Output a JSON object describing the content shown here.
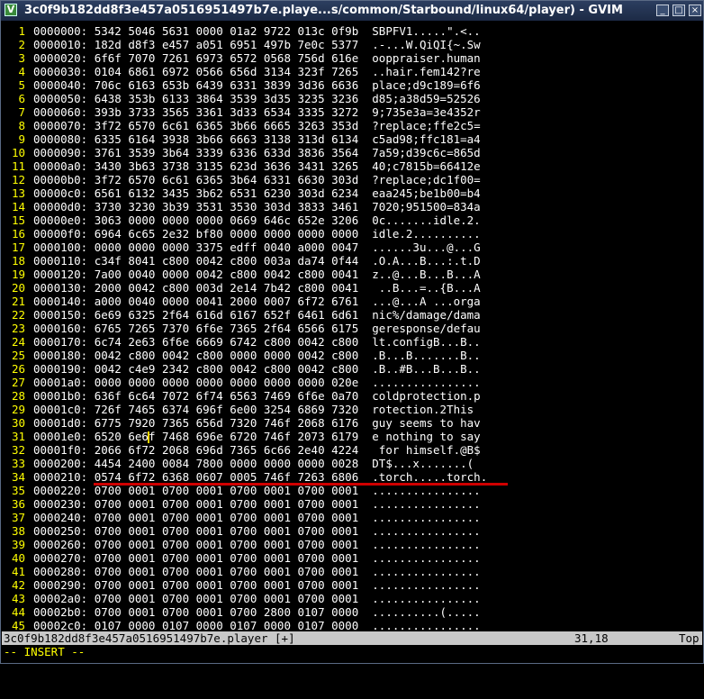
{
  "window": {
    "title": "3c0f9b182dd8f3e457a0516951497b7e.playe...s/common/Starbound/linux64/player) - GVIM",
    "buttons": {
      "minimize": "_",
      "maximize": "□",
      "close": "×"
    }
  },
  "buffer": {
    "lines": [
      {
        "n": "1",
        "text": "0000000: 5342 5046 5631 0000 01a2 9722 013c 0f9b  SBPFV1.....\".<.."
      },
      {
        "n": "2",
        "text": "0000010: 182d d8f3 e457 a051 6951 497b 7e0c 5377  .-...W.QiQI{~.Sw"
      },
      {
        "n": "3",
        "text": "0000020: 6f6f 7070 7261 6973 6572 0568 756d 616e  ooppraiser.human"
      },
      {
        "n": "4",
        "text": "0000030: 0104 6861 6972 0566 656d 3134 323f 7265  ..hair.fem142?re"
      },
      {
        "n": "5",
        "text": "0000040: 706c 6163 653b 6439 6331 3839 3d36 6636  place;d9c189=6f6"
      },
      {
        "n": "6",
        "text": "0000050: 6438 353b 6133 3864 3539 3d35 3235 3236  d85;a38d59=52526"
      },
      {
        "n": "7",
        "text": "0000060: 393b 3733 3565 3361 3d33 6534 3335 3272  9;735e3a=3e4352r"
      },
      {
        "n": "8",
        "text": "0000070: 3f72 6570 6c61 6365 3b66 6665 3263 353d  ?replace;ffe2c5="
      },
      {
        "n": "9",
        "text": "0000080: 6335 6164 3938 3b66 6663 3138 313d 6134  c5ad98;ffc181=a4"
      },
      {
        "n": "10",
        "text": "0000090: 3761 3539 3b64 3339 6336 633d 3836 3564  7a59;d39c6c=865d"
      },
      {
        "n": "11",
        "text": "00000a0: 3430 3b63 3738 3135 623d 3636 3431 3265  40;c7815b=66412e"
      },
      {
        "n": "12",
        "text": "00000b0: 3f72 6570 6c61 6365 3b64 6331 6630 303d  ?replace;dc1f00="
      },
      {
        "n": "13",
        "text": "00000c0: 6561 6132 3435 3b62 6531 6230 303d 6234  eaa245;be1b00=b4"
      },
      {
        "n": "14",
        "text": "00000d0: 3730 3230 3b39 3531 3530 303d 3833 3461  7020;951500=834a"
      },
      {
        "n": "15",
        "text": "00000e0: 3063 0000 0000 0000 0669 646c 652e 3206  0c.......idle.2."
      },
      {
        "n": "16",
        "text": "00000f0: 6964 6c65 2e32 bf80 0000 0000 0000 0000  idle.2.........."
      },
      {
        "n": "17",
        "text": "0000100: 0000 0000 0000 3375 edff 0040 a000 0047  ......3u...@...G"
      },
      {
        "n": "18",
        "text": "0000110: c34f 8041 c800 0042 c800 003a da74 0f44  .O.A...B...:.t.D"
      },
      {
        "n": "19",
        "text": "0000120: 7a00 0040 0000 0042 c800 0042 c800 0041  z..@...B...B...A"
      },
      {
        "n": "20",
        "text": "0000130: 2000 0042 c800 003d 2e14 7b42 c800 0041   ..B...=..{B...A"
      },
      {
        "n": "21",
        "text": "0000140: a000 0040 0000 0041 2000 0007 6f72 6761  ...@...A ...orga"
      },
      {
        "n": "22",
        "text": "0000150: 6e69 6325 2f64 616d 6167 652f 6461 6d61  nic%/damage/dama"
      },
      {
        "n": "23",
        "text": "0000160: 6765 7265 7370 6f6e 7365 2f64 6566 6175  geresponse/defau"
      },
      {
        "n": "24",
        "text": "0000170: 6c74 2e63 6f6e 6669 6742 c800 0042 c800  lt.configB...B.."
      },
      {
        "n": "25",
        "text": "0000180: 0042 c800 0042 c800 0000 0000 0042 c800  .B...B.......B.."
      },
      {
        "n": "26",
        "text": "0000190: 0042 c4e9 2342 c800 0042 c800 0042 c800  .B..#B...B...B.."
      },
      {
        "n": "27",
        "text": "00001a0: 0000 0000 0000 0000 0000 0000 0000 020e  ................"
      },
      {
        "n": "28",
        "text": "00001b0: 636f 6c64 7072 6f74 6563 7469 6f6e 0a70  coldprotection.p"
      },
      {
        "n": "29",
        "text": "00001c0: 726f 7465 6374 696f 6e00 3254 6869 7320  rotection.2This "
      },
      {
        "n": "30",
        "text": "00001d0: 6775 7920 7365 656d 7320 746f 2068 6176  guy seems to hav"
      },
      {
        "n": "31",
        "text": "00001e0: 6520 6e6|f 7468 696e 6720 746f 2073 6179  e nothing to say"
      },
      {
        "n": "32",
        "text": "00001f0: 2066 6f72 2068 696d 7365 6c66 2e40 4224   for himself.@B$"
      },
      {
        "n": "33",
        "text": "0000200: 4454 2400 0084 7800 0000 0000 0000 0028  DT$...x.......("
      },
      {
        "n": "34",
        "text": "0000210: 0574 6f72 6368 0607 0005 746f 7263 6806  .torch.....torch."
      },
      {
        "n": "35",
        "text": "0000220: 0700 0001 0700 0001 0700 0001 0700 0001  ................"
      },
      {
        "n": "36",
        "text": "0000230: 0700 0001 0700 0001 0700 0001 0700 0001  ................"
      },
      {
        "n": "37",
        "text": "0000240: 0700 0001 0700 0001 0700 0001 0700 0001  ................"
      },
      {
        "n": "38",
        "text": "0000250: 0700 0001 0700 0001 0700 0001 0700 0001  ................"
      },
      {
        "n": "39",
        "text": "0000260: 0700 0001 0700 0001 0700 0001 0700 0001  ................"
      },
      {
        "n": "40",
        "text": "0000270: 0700 0001 0700 0001 0700 0001 0700 0001  ................"
      },
      {
        "n": "41",
        "text": "0000280: 0700 0001 0700 0001 0700 0001 0700 0001  ................"
      },
      {
        "n": "42",
        "text": "0000290: 0700 0001 0700 0001 0700 0001 0700 0001  ................"
      },
      {
        "n": "43",
        "text": "00002a0: 0700 0001 0700 0001 0700 0001 0700 0001  ................"
      },
      {
        "n": "44",
        "text": "00002b0: 0700 0001 0700 0001 0700 2800 0107 0000  ..........(....."
      },
      {
        "n": "45",
        "text": "00002c0: 0107 0000 0107 0000 0107 0000 0107 0000  ................"
      }
    ]
  },
  "statusline": {
    "filename": "3c0f9b182dd8f3e457a0516951497b7e.player [+]",
    "position": "31,18",
    "scroll": "Top"
  },
  "mode": "-- INSERT --",
  "colors": {
    "background": "#000000",
    "line_numbers": "#ffff00",
    "text": "#ffffff",
    "annotation_line": "#d00000",
    "statusline_bg": "#c8c8c8"
  }
}
